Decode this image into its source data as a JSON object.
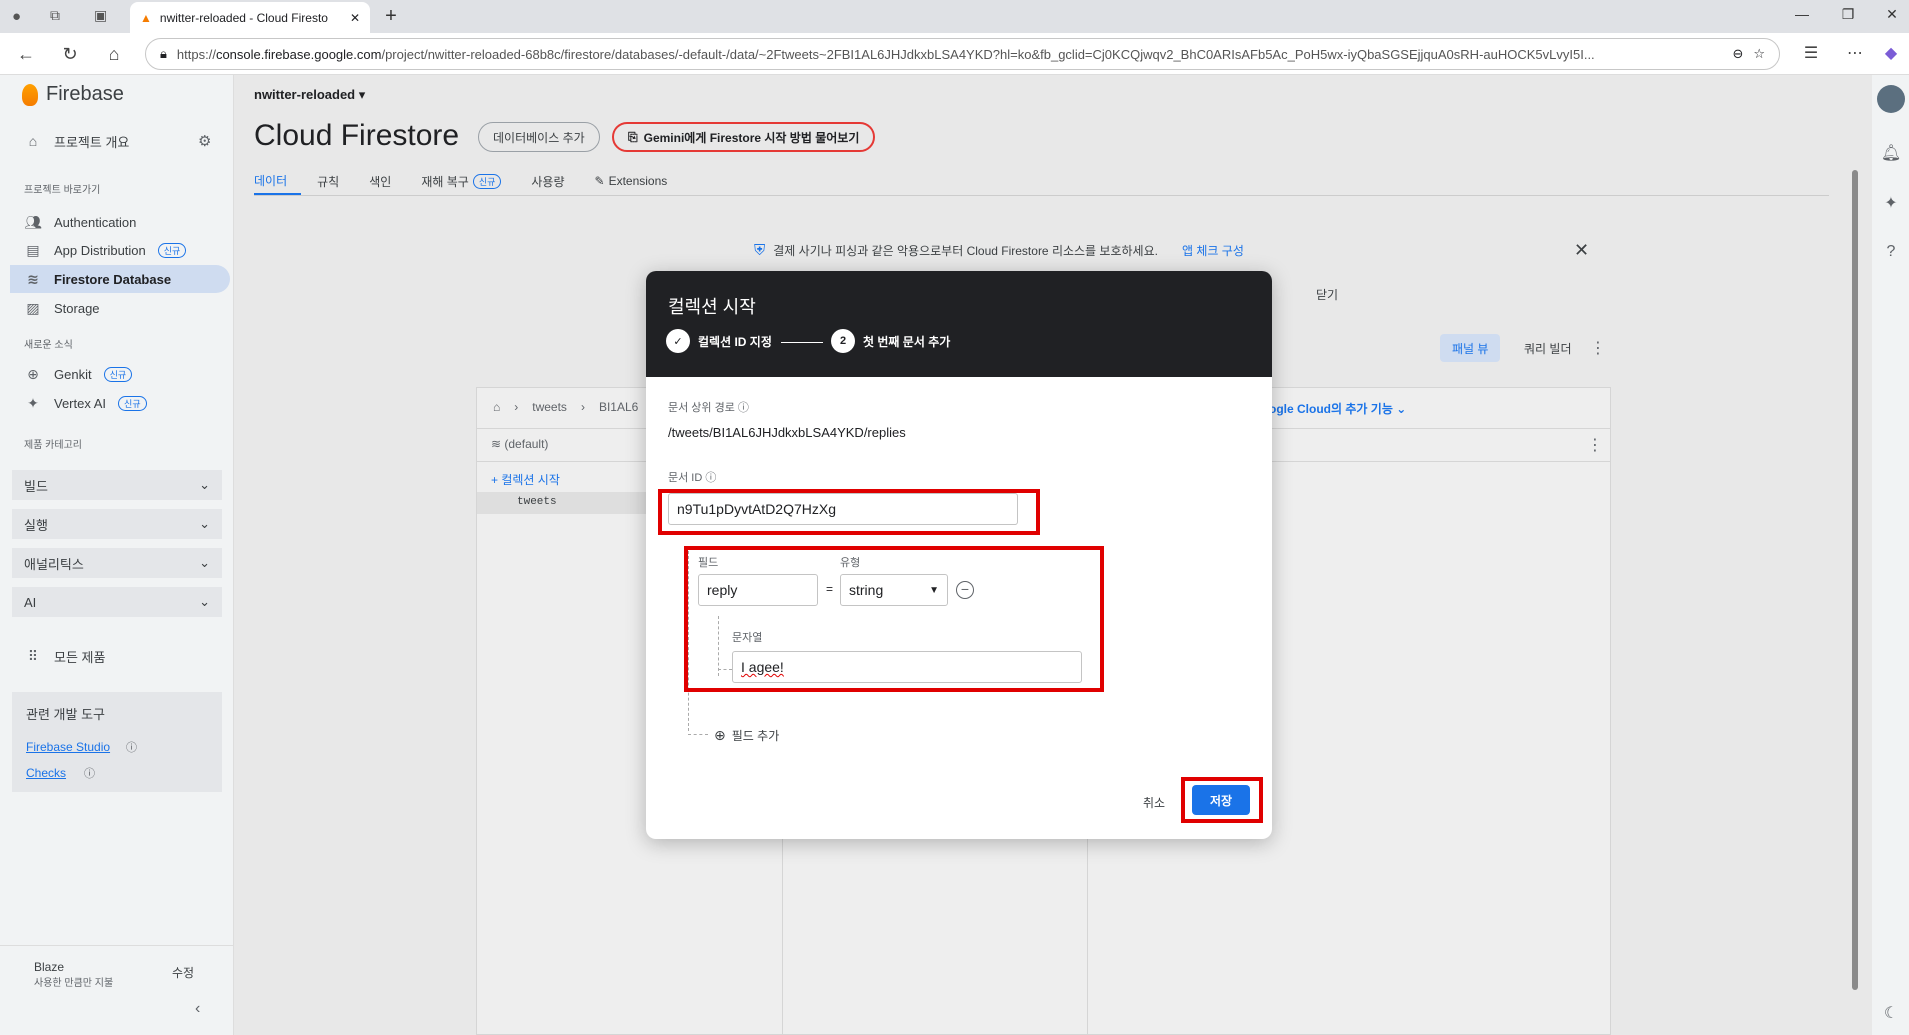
{
  "browser": {
    "tab_title": "nwitter-reloaded - Cloud Firesto",
    "url_prefix": "https://",
    "url_host": "console.firebase.google.com",
    "url_path": "/project/nwitter-reloaded-68b8c/firestore/databases/-default-/data/~2Ftweets~2FBI1AL6JHJdkxbLSA4YKD?hl=ko&fb_gclid=Cj0KCQjwqv2_BhC0ARIsAFb5Ac_PoH5wx-iyQbaSGSEjjquA0sRH-auHOCK5vLvyI5I..."
  },
  "sidebar": {
    "brand": "Firebase",
    "overview": "프로젝트 개요",
    "shortcuts_caption": "프로젝트 바로가기",
    "items": [
      {
        "label": "Authentication",
        "badge": ""
      },
      {
        "label": "App Distribution",
        "badge": "신규"
      },
      {
        "label": "Firestore Database",
        "badge": ""
      },
      {
        "label": "Storage",
        "badge": ""
      }
    ],
    "news_caption": "새로운 소식",
    "news_items": [
      {
        "label": "Genkit",
        "badge": "신규"
      },
      {
        "label": "Vertex AI",
        "badge": "신규"
      }
    ],
    "category_caption": "제품 카테고리",
    "groups": [
      "빌드",
      "실행",
      "애널리틱스",
      "AI"
    ],
    "all_products": "모든 제품",
    "devtools_title": "관련 개발 도구",
    "devtools_links": [
      "Firebase Studio",
      "Checks"
    ],
    "plan_name": "Blaze",
    "plan_sub": "사용한 만큼만 지불",
    "plan_edit": "수정"
  },
  "main": {
    "project": "nwitter-reloaded",
    "title": "Cloud Firestore",
    "add_db": "데이터베이스 추가",
    "gemini": "Gemini에게 Firestore 시작 방법 물어보기",
    "tabs": [
      "데이터",
      "규칙",
      "색인",
      "재해 복구",
      "사용량",
      "Extensions"
    ],
    "tab_badge": "신규",
    "banner_text": "결제 사기나 피싱과 같은 악용으로부터 Cloud Firestore 리소스를 보호하세요.",
    "banner_link": "앱 체크 구성",
    "dismiss": "닫기",
    "panel_view": "패널 뷰",
    "query_builder": "쿼리 빌더",
    "crumb_collection": "tweets",
    "crumb_doc": "BI1AL6",
    "gcloud": "Google Cloud의 추가 기능",
    "db_name": "(default)",
    "start_collection": "컬렉션 시작",
    "collection_item": "tweets"
  },
  "modal": {
    "title": "컬렉션 시작",
    "step1": "컬렉션 ID 지정",
    "step2_num": "2",
    "step2": "첫 번째 문서 추가",
    "parent_path_label": "문서 상위 경로",
    "parent_path": "/tweets/BI1AL6JHJdkxbLSA4YKD/replies",
    "doc_id_label": "문서 ID",
    "doc_id": "n9Tu1pDyvtAtD2Q7HzXg",
    "field_label": "필드",
    "type_label": "유형",
    "field_name": "reply",
    "equals": "=",
    "field_type": "string",
    "string_label": "문자열",
    "string_value": "I agee!",
    "add_field": "필드 추가",
    "cancel": "취소",
    "save": "저장"
  },
  "colors": {
    "accent": "#1a73e8",
    "highlight": "#e00000",
    "modal_header": "#202124"
  }
}
